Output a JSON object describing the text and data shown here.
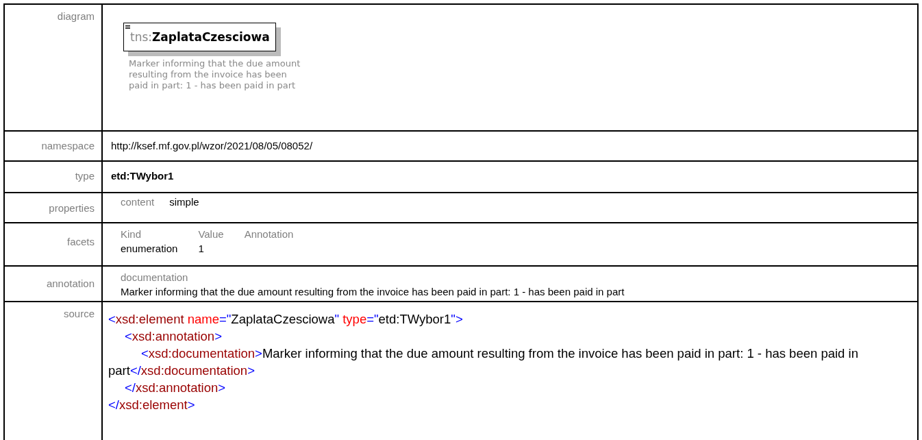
{
  "diagram": {
    "label": "diagram",
    "element": {
      "prefix": "tns:",
      "name": "ZaplataCzesciowa"
    },
    "description": "Marker informing that the due amount resulting from the invoice has been paid in part: 1 - has been paid in part"
  },
  "namespace": {
    "label": "namespace",
    "value": "http://ksef.mf.gov.pl/wzor/2021/08/05/08052/"
  },
  "type": {
    "label": "type",
    "value": "etd:TWybor1"
  },
  "properties": {
    "label": "properties",
    "items": [
      {
        "name": "content",
        "value": "simple"
      }
    ]
  },
  "facets": {
    "label": "facets",
    "columns": [
      "Kind",
      "Value",
      "Annotation"
    ],
    "rows": [
      [
        "enumeration",
        "1",
        ""
      ]
    ]
  },
  "annotation": {
    "label": "annotation",
    "heading": "documentation",
    "text": "Marker informing that the due amount resulting from the invoice has been paid in part: 1 - has been paid in part"
  },
  "source": {
    "label": "source",
    "lines": [
      {
        "tokens": [
          {
            "kind": "punct",
            "text": "<"
          },
          {
            "kind": "tag",
            "text": "xsd:element"
          },
          {
            "kind": "attr",
            "text": " name"
          },
          {
            "kind": "punct",
            "text": "=\""
          },
          {
            "kind": "text",
            "text": "ZaplataCzesciowa"
          },
          {
            "kind": "punct",
            "text": "\""
          },
          {
            "kind": "attr",
            "text": " type"
          },
          {
            "kind": "punct",
            "text": "=\""
          },
          {
            "kind": "text",
            "text": "etd:TWybor1"
          },
          {
            "kind": "punct",
            "text": "\">"
          }
        ],
        "children": [
          {
            "tokens": [
              {
                "kind": "punct",
                "text": "<"
              },
              {
                "kind": "tag",
                "text": "xsd:annotation"
              },
              {
                "kind": "punct",
                "text": ">"
              }
            ],
            "children": [
              {
                "tokens": [
                  {
                    "kind": "punct",
                    "text": "<"
                  },
                  {
                    "kind": "tag",
                    "text": "xsd:documentation"
                  },
                  {
                    "kind": "punct",
                    "text": ">"
                  },
                  {
                    "kind": "text",
                    "text": "Marker informing that the due amount resulting from the invoice has been paid in part: 1 - has been paid in part"
                  },
                  {
                    "kind": "punct",
                    "text": "</"
                  },
                  {
                    "kind": "tag",
                    "text": "xsd:documentation"
                  },
                  {
                    "kind": "punct",
                    "text": ">"
                  }
                ]
              }
            ]
          },
          {
            "tokens": [
              {
                "kind": "punct",
                "text": "</"
              },
              {
                "kind": "tag",
                "text": "xsd:annotation"
              },
              {
                "kind": "punct",
                "text": ">"
              }
            ]
          }
        ]
      },
      {
        "tokens": [
          {
            "kind": "punct",
            "text": "</"
          },
          {
            "kind": "tag",
            "text": "xsd:element"
          },
          {
            "kind": "punct",
            "text": ">"
          }
        ]
      }
    ]
  }
}
